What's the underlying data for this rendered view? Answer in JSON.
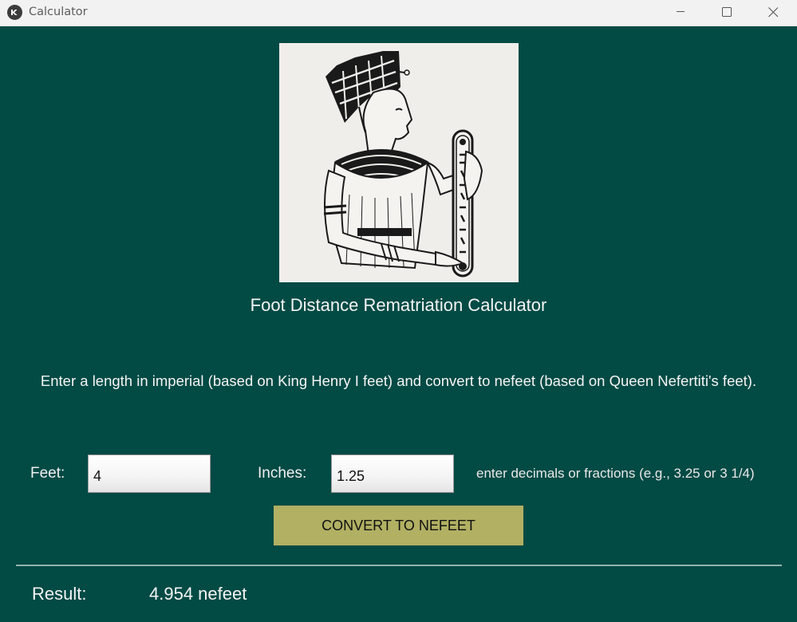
{
  "window": {
    "title": "Calculator",
    "app_icon": "kivy-logo-icon",
    "controls": {
      "minimize_icon": "minimize-icon",
      "maximize_icon": "maximize-icon",
      "close_icon": "close-icon"
    }
  },
  "image": {
    "subject": "nefertiti-holding-cartouche-ruler"
  },
  "main": {
    "title": "Foot Distance Rematriation Calculator",
    "description": "Enter a length in imperial (based on King Henry I feet) and convert to nefeet (based on Queen Nefertiti's feet).",
    "feet_label": "Feet:",
    "feet_value": "4",
    "inches_label": "Inches:",
    "inches_value": "1.25",
    "hint": "enter decimals or fractions (e.g., 3.25 or 3 1/4)",
    "convert_button": "CONVERT TO NEFEET",
    "result_label": "Result:",
    "result_value": "4.954 nefeet"
  },
  "colors": {
    "background": "#024a44",
    "button": "#b1b063",
    "text": "#f4f4f4",
    "titlebar": "#f2f2f2"
  }
}
